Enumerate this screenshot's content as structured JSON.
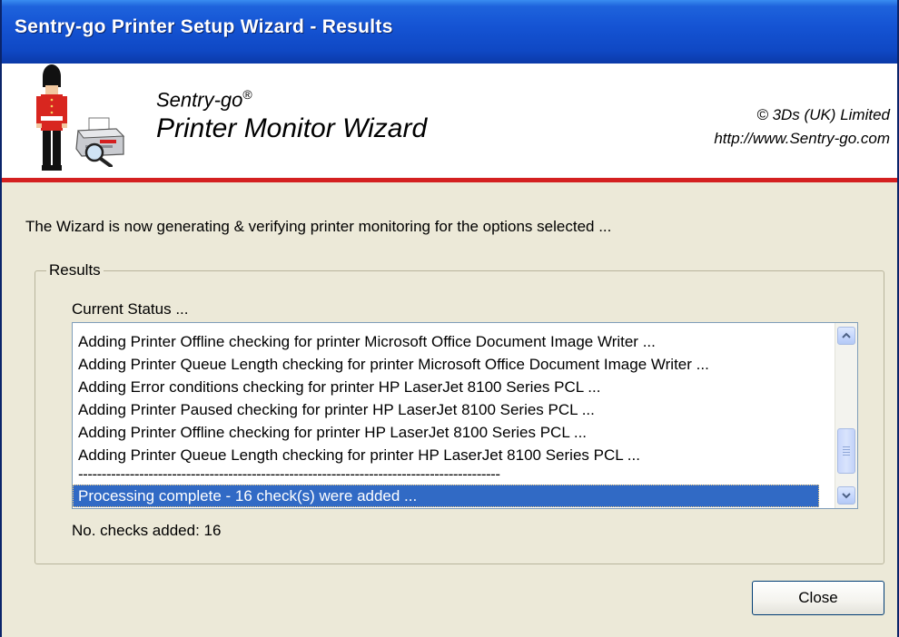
{
  "window": {
    "title": "Sentry-go Printer Setup Wizard - Results"
  },
  "header": {
    "brand_line1": "Sentry-go",
    "brand_reg": "®",
    "brand_line2": "Printer Monitor Wizard",
    "company": "© 3Ds (UK) Limited",
    "url": "http://www.Sentry-go.com",
    "rule_color": "#d42020"
  },
  "main": {
    "intro": "The Wizard is now generating & verifying printer monitoring for the options selected ...",
    "group_label": "Results",
    "status_label": "Current Status ...",
    "status_items": [
      "Adding Printer Offline checking for printer Microsoft Office Document Image Writer ...",
      "Adding Printer Queue Length checking for printer Microsoft Office Document Image Writer ...",
      "Adding Error conditions checking for printer HP LaserJet 8100 Series PCL ...",
      "Adding Printer Paused checking for printer HP LaserJet 8100 Series PCL ...",
      "Adding Printer Offline checking for printer HP LaserJet 8100 Series PCL ...",
      "Adding Printer Queue Length checking for printer HP LaserJet 8100 Series PCL ...",
      "------------------------------------------------------------------------------------------",
      "Processing complete - 16 check(s) were added ..."
    ],
    "selected_item": "Processing complete - 16 check(s) were added ...",
    "checks_added": "No. checks added: 16"
  },
  "footer": {
    "close_label": "Close"
  },
  "icons": {
    "guard": "guardsman-icon",
    "printer": "printer-magnifier-icon",
    "scroll_up": "chevron-up-icon",
    "scroll_down": "chevron-down-icon"
  }
}
